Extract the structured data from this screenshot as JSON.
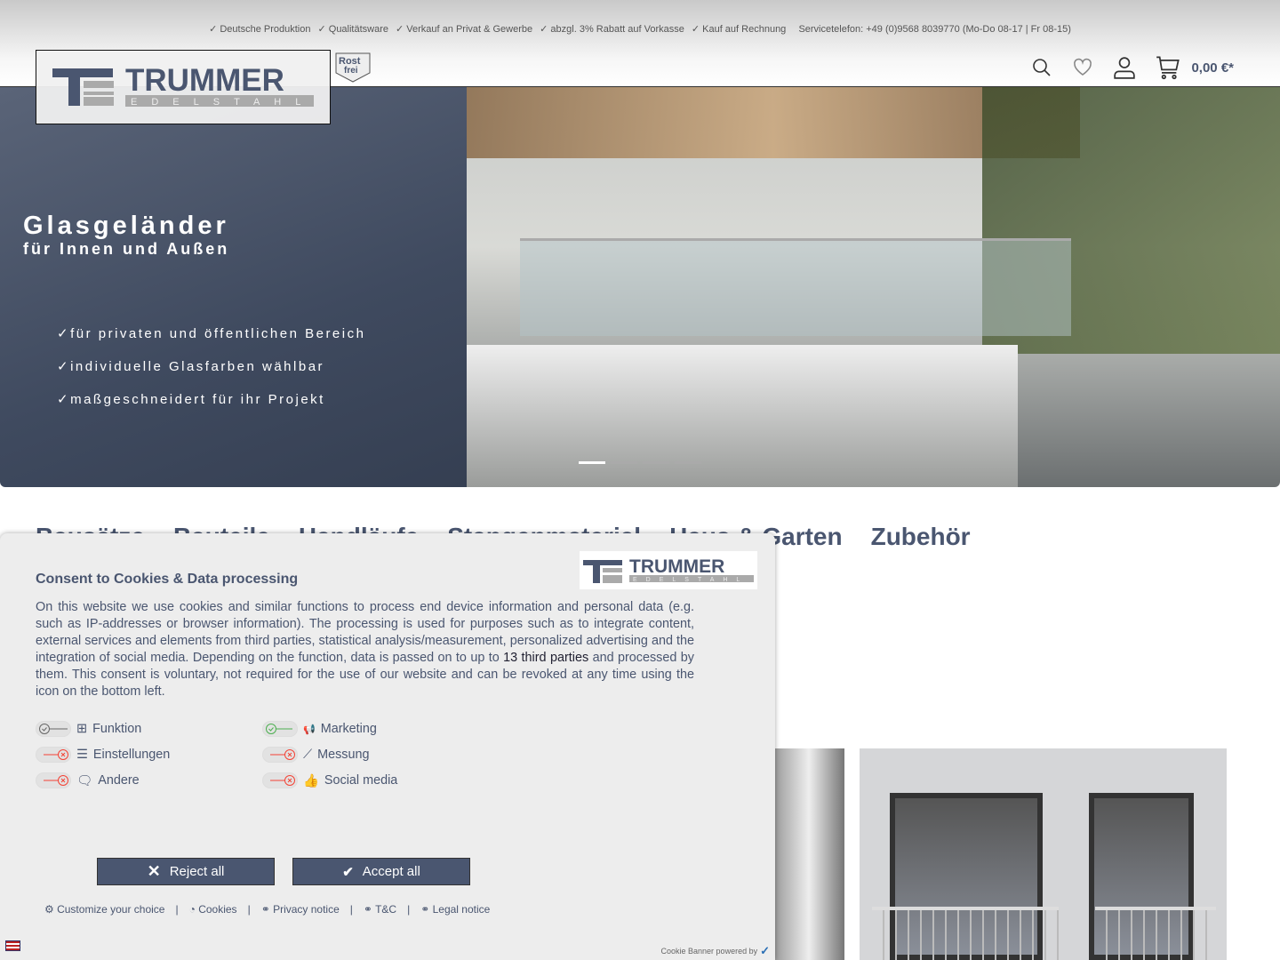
{
  "topbar": {
    "usps": [
      "✓ Deutsche Produktion",
      "✓ Qualitätsware",
      "✓ Verkauf an Privat & Gewerbe",
      "✓ abzgl. 3% Rabatt auf Vorkasse",
      "✓ Kauf auf Rechnung"
    ],
    "service": "Servicetelefon: +49 (0)9568 8039770 (Mo-Do 08-17 | Fr 08-15)"
  },
  "logo": {
    "name": "TRUMMER",
    "sub": "EDELSTAHL",
    "badge": "Rost frei"
  },
  "header": {
    "icons": [
      "search-icon",
      "heart-icon",
      "user-icon",
      "cart-icon"
    ],
    "cart_total": "0,00 €*"
  },
  "hero": {
    "title": "Glasgeländer",
    "subtitle": "für Innen und Außen",
    "bullets": [
      "für privaten und öffentlichen Bereich",
      "individuelle Glasfarben wählbar",
      "maßgeschneidert für ihr Projekt"
    ],
    "slides": 4,
    "active_slide": 1
  },
  "nav": [
    "Bausätze",
    "Bauteile",
    "Handläufe",
    "Stangenmaterial",
    "Haus & Garten",
    "Zubehör"
  ],
  "consent": {
    "title": "Consent to Cookies & Data processing",
    "text_before": "On this website we use cookies and similar functions to process end device information and personal data (e.g. such as IP-addresses or browser information). The processing is used for purposes such as to integrate content, external services and elements from third parties, statistical analysis/measurement, personalized advertising and the integration of social media. Depending on the function, data is passed on to up to ",
    "third_parties": "13 third parties",
    "text_after": " and processed by them. This consent is voluntary, not required for the use of our website and can be revoked at any time using the icon on the bottom left.",
    "options": [
      {
        "label": "Funktion",
        "state": "on-grey"
      },
      {
        "label": "Marketing",
        "state": "on"
      },
      {
        "label": "Einstellungen",
        "state": "off"
      },
      {
        "label": "Messung",
        "state": "off"
      },
      {
        "label": "Andere",
        "state": "off"
      },
      {
        "label": "Social media",
        "state": "off"
      }
    ],
    "reject": "Reject all",
    "accept": "Accept all",
    "links": [
      "Customize your choice",
      "Cookies",
      "Privacy notice",
      "T&C",
      "Legal notice"
    ],
    "powered": "Cookie Banner powered by",
    "colors": {
      "primary": "#4a5670",
      "on": "#4caf50",
      "off": "#f44336"
    }
  }
}
